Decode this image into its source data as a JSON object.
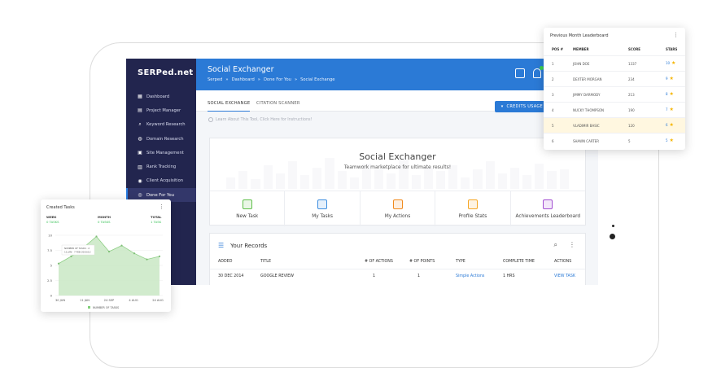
{
  "app": {
    "logo": "SERPed.net",
    "title": "Social Exchanger",
    "breadcrumb": [
      "Serped",
      "»",
      "Dashboard",
      "»",
      "Done For You",
      "»",
      "Social Exchange"
    ],
    "user_initial": "V",
    "accent": "#2b7ad6",
    "sidebar_bg": "#22254e"
  },
  "sidebar": {
    "items": [
      {
        "label": "Dashboard",
        "icon": "grid-icon"
      },
      {
        "label": "Project Manager",
        "icon": "folder-icon"
      },
      {
        "label": "Keyword Research",
        "icon": "search-icon"
      },
      {
        "label": "Domain Research",
        "icon": "globe-icon"
      },
      {
        "label": "Site Management",
        "icon": "sitemap-icon"
      },
      {
        "label": "Rank Tracking",
        "icon": "chart-icon"
      },
      {
        "label": "Client Acquisition",
        "icon": "user-icon"
      },
      {
        "label": "Done For You",
        "icon": "check-circle-icon",
        "active": true
      }
    ]
  },
  "tabs": {
    "social_exchange": "SOCIAL EXCHANGE",
    "citation_scanner": "CITATION SCANNER",
    "credits_usage": "CREDITS USAGE"
  },
  "learn_text": "Learn About This Tool, Click Here for Instructions!",
  "hero": {
    "title": "Social Exchanger",
    "subtitle": "Teamwork marketplace for ultimate results!",
    "actions": [
      {
        "label": "New Task",
        "color": "#5fbf4a"
      },
      {
        "label": "My Tasks",
        "color": "#3f8fe0"
      },
      {
        "label": "My Actions",
        "color": "#f08a1c"
      },
      {
        "label": "Profile Stats",
        "color": "#f5a623"
      },
      {
        "label": "Achievements Leaderboard",
        "color": "#a24fd1"
      }
    ]
  },
  "records": {
    "title": "Your Records",
    "columns": [
      "ADDED",
      "TITLE",
      "# OF ACTIONS",
      "# OF POINTS",
      "TYPE",
      "COMPLETE TIME",
      "ACTIONS"
    ],
    "rows": [
      {
        "added": "30 DEC 2014",
        "title": "GOOGLE REVIEW",
        "actions": "1",
        "points": "1",
        "type": "Simple Actions",
        "time": "1 HRS",
        "action": "VIEW TASK"
      }
    ]
  },
  "leaderboard": {
    "title": "Previous Month Leaderboard",
    "columns": [
      "POS #",
      "MEMBER",
      "SCORE",
      "STARS"
    ],
    "rows": [
      {
        "pos": "1",
        "member": "JOHN DOE",
        "score": "1337",
        "stars": "10"
      },
      {
        "pos": "2",
        "member": "DEXTER MORGAN",
        "score": "234",
        "stars": "9"
      },
      {
        "pos": "3",
        "member": "JIMMY DARMODY",
        "score": "213",
        "stars": "8"
      },
      {
        "pos": "4",
        "member": "NUCKY THOMPSON",
        "score": "190",
        "stars": "7"
      },
      {
        "pos": "5",
        "member": "VLADIMIR BASIC",
        "score": "120",
        "stars": "6",
        "highlight": true
      },
      {
        "pos": "6",
        "member": "SHAWN CARTER",
        "score": "5",
        "stars": "5"
      }
    ]
  },
  "created_tasks": {
    "title": "Created Tasks",
    "stats": [
      {
        "label": "WEEK",
        "value": "0 TASKS"
      },
      {
        "label": "MONTH",
        "value": "0 TASKS"
      },
      {
        "label": "TOTAL",
        "value": "1 TASK"
      }
    ],
    "tooltip": [
      "NUMBER OF TASKS : 2",
      "11 JAN - 7 FEB 2015/12"
    ]
  },
  "chart_data": {
    "type": "area",
    "categories": [
      "30 JUN",
      "11 JAN",
      "24 SEP",
      "4 AUG",
      "24 AUG"
    ],
    "series": [
      {
        "name": "NUMBER OF TASKS",
        "values": [
          5.3,
          6.5,
          8.0,
          9.8,
          7.3,
          8.3,
          7.0,
          6.0,
          6.5
        ]
      }
    ],
    "yticks": [
      "10",
      "7.5",
      "5",
      "2.5",
      "0"
    ],
    "ylim": [
      0,
      10
    ],
    "legend": "bottom",
    "grid": true
  }
}
